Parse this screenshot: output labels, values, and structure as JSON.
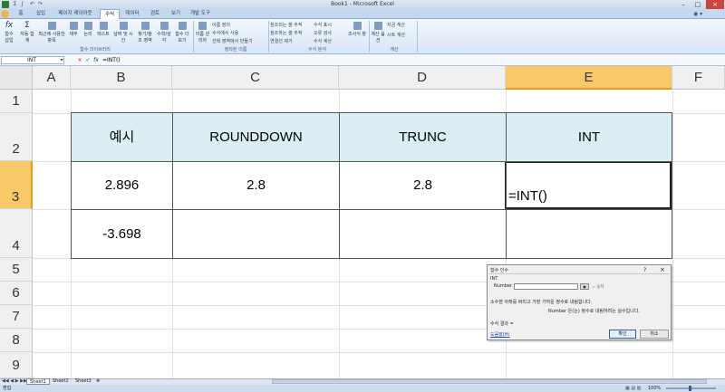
{
  "app": {
    "title": "Book1 - Microsoft Excel",
    "quick_access": [
      "Σ",
      "∫",
      "↶",
      "↷"
    ]
  },
  "ribbon": {
    "tabs": [
      "홈",
      "삽입",
      "페이지 레이아웃",
      "수식",
      "데이터",
      "검토",
      "보기",
      "개발 도구"
    ],
    "active_tab_index": 3,
    "big_buttons": [
      "함수 삽입",
      "자동 합계",
      "최근에 사용한 항목",
      "재무",
      "논리",
      "텍스트",
      "날짜 및 시간",
      "찾기/참조 영역",
      "수학/삼각",
      "함수 더 보기"
    ],
    "name_manager": "이름 관리자",
    "define_name_items": [
      "이름 정의",
      "수식에서 사용",
      "선택 영역에서 만들기"
    ],
    "audit_items": [
      "참조되는 셀 추적",
      "참조하는 셀 추적",
      "연결선 제거",
      "수식 표시",
      "오류 검사",
      "수식 계산"
    ],
    "watch_window": "조사식 창",
    "calc_options": "계산 옵션",
    "calc_items": [
      "지금 계산",
      "시트 계산"
    ],
    "groups": [
      "함수 라이브러리",
      "정의된 이름",
      "수식 분석",
      "계산"
    ]
  },
  "formula_bar": {
    "name_box": "INT",
    "formula": "=INT()"
  },
  "columns": [
    "A",
    "B",
    "C",
    "D",
    "E",
    "F"
  ],
  "selected_column": "E",
  "rows": [
    "1",
    "2",
    "3",
    "4",
    "5",
    "6",
    "7",
    "8",
    "9"
  ],
  "selected_row": "3",
  "table": {
    "headers": [
      "예시",
      "ROUNDDOWN",
      "TRUNC",
      "INT"
    ],
    "row3": [
      "2.896",
      "2.8",
      "2.8",
      "=INT()"
    ],
    "row4": [
      "-3.698",
      "",
      "",
      ""
    ]
  },
  "dialog": {
    "title": "함수 인수",
    "help_glyph": "?",
    "close_glyph": "×",
    "function_name": "INT",
    "arg_label": "Number",
    "arg_result": "=  숫자",
    "description": "소수점 아래를 버리고 가장 가까운 정수로 내림합니다.",
    "arg_description": "Number  은(는) 정수로 내림하려는 실수입니다.",
    "result_label": "수식 결과 =",
    "help_link": "도움말(H)",
    "ok": "확인",
    "cancel": "취소"
  },
  "sheets": [
    "Sheet1",
    "Sheet2",
    "Sheet3"
  ],
  "status": {
    "mode": "편집",
    "zoom": "100%"
  }
}
